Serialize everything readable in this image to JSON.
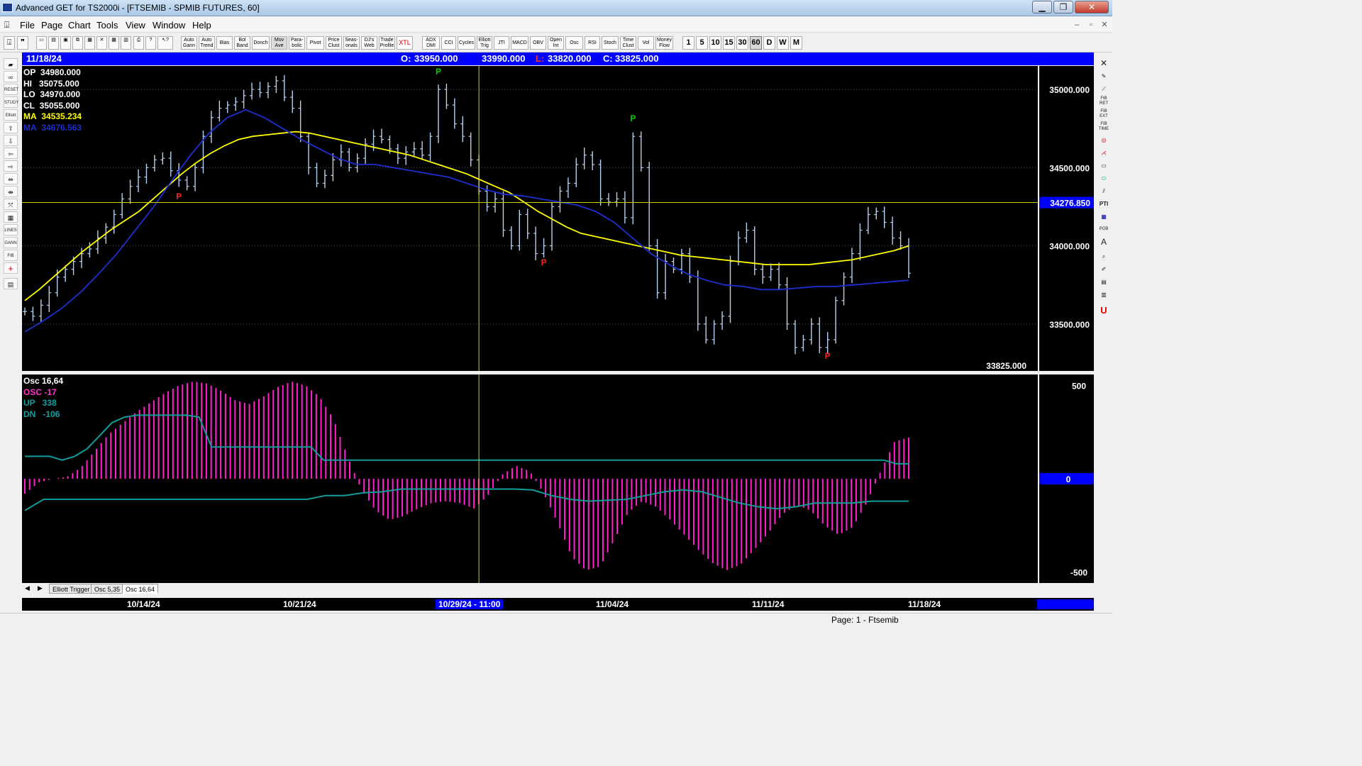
{
  "window": {
    "title": "Advanced GET for TS2000i - [FTSEMIB - SPMIB FUTURES, 60]",
    "min": "▁",
    "max": "❐",
    "close": "✕"
  },
  "menu": {
    "items": [
      "File",
      "Page",
      "Chart",
      "Tools",
      "View",
      "Window",
      "Help"
    ]
  },
  "toolbar": {
    "indicators": [
      "Auto Gann",
      "Auto Trend",
      "Bias",
      "Bol Band",
      "Donch",
      "Mov Ave",
      "Para- bolic",
      "Pivot",
      "Price Clust",
      "Seas- onals",
      "DJ's Web",
      "Trade Profile",
      "XTL",
      "ADX DMI",
      "CCI",
      "Cycles",
      "Elliott Trig",
      "JTI",
      "MACD",
      "OBV",
      "Open Int",
      "Osc",
      "RSI",
      "Stoch",
      "Time Clust",
      "Vol",
      "Money Flow"
    ],
    "intervals": [
      "1",
      "5",
      "10",
      "15",
      "30",
      "60",
      "D",
      "W",
      "M"
    ],
    "active_interval": "60"
  },
  "info": {
    "date": "11/18/24",
    "open_label": "O:",
    "open": "33950.000",
    "high": "33990.000",
    "low_label": "L:",
    "low": "33820.000",
    "close_label": "C:",
    "close": "33825.000"
  },
  "price_panel": {
    "readouts": [
      {
        "label": "OP",
        "value": "34980.000",
        "color": "#ffffff"
      },
      {
        "label": "HI",
        "value": "35075.000",
        "color": "#ffffff"
      },
      {
        "label": "LO",
        "value": "34970.000",
        "color": "#ffffff"
      },
      {
        "label": "CL",
        "value": "35055.000",
        "color": "#ffffff"
      },
      {
        "label": "MA",
        "value": "34535.234",
        "color": "#ffff00"
      },
      {
        "label": "MA",
        "value": "34676.563",
        "color": "#1e2fd0"
      }
    ],
    "axis_ticks": [
      "35000.000",
      "34500.000",
      "34000.000",
      "33500.000"
    ],
    "crosshair_price": "34276.850",
    "last_price": "33825.000",
    "pivot_label": "P"
  },
  "osc_panel": {
    "readouts": [
      {
        "label": "Osc 16,64",
        "value": "",
        "color": "#ffffff"
      },
      {
        "label": "OSC",
        "value": "-17",
        "color": "#ff33cc"
      },
      {
        "label": "UP",
        "value": "338",
        "color": "#11a0a0"
      },
      {
        "label": "DN",
        "value": "-106",
        "color": "#11a0a0"
      }
    ],
    "axis_ticks": [
      "500",
      "0",
      "-500"
    ]
  },
  "tabs": [
    "Elliott Trigger",
    "Osc 5,35",
    "Osc 16,64"
  ],
  "dates": {
    "labels": [
      "10/14/24",
      "10/21/24",
      "11/04/24",
      "11/11/24",
      "11/18/24"
    ],
    "cursor": "10/29/24 - 11:00"
  },
  "status": {
    "text": "Page: 1 - Ftsemib"
  },
  "colors": {
    "candle": "#b8d0f0",
    "ma_fast": "#ffff00",
    "ma_slow": "#1e2fd0",
    "osc": "#ff22cc",
    "band": "#119c9c",
    "pivot_high": "#00cc00",
    "pivot_low": "#ff2020",
    "info_bar": "#0000ff"
  },
  "chart_data": {
    "type": "line",
    "symbol": "FTSEMIB - SPMIB FUTURES",
    "interval": "60",
    "price_close": [
      33580,
      33550,
      33620,
      33700,
      33800,
      33850,
      33900,
      33950,
      33980,
      34050,
      34120,
      34200,
      34300,
      34380,
      34440,
      34500,
      34550,
      34560,
      34480,
      34420,
      34380,
      34500,
      34700,
      34820,
      34880,
      34900,
      34920,
      34960,
      35000,
      34980,
      35020,
      35055,
      34950,
      34880,
      34700,
      34500,
      34400,
      34450,
      34550,
      34600,
      34500,
      34560,
      34650,
      34700,
      34680,
      34620,
      34560,
      34600,
      34620,
      34580,
      34700,
      35000,
      34900,
      34780,
      34700,
      34550,
      34350,
      34250,
      34300,
      34100,
      34000,
      34200,
      34080,
      33950,
      34000,
      34250,
      34350,
      34400,
      34520,
      34580,
      34520,
      34300,
      34280,
      34300,
      34180,
      34700,
      34500,
      34000,
      33700,
      33900,
      33850,
      33950,
      33800,
      33500,
      33400,
      33500,
      33550,
      33900,
      34050,
      34100,
      33850,
      33800,
      33850,
      33750,
      33500,
      33350,
      33400,
      33500,
      33350,
      33400,
      33650,
      33800,
      33950,
      34100,
      34200,
      34220,
      34150,
      34050,
      34000,
      33825
    ],
    "ma_fast": [
      33650,
      33720,
      33800,
      33880,
      33960,
      34030,
      34100,
      34160,
      34220,
      34300,
      34380,
      34460,
      34530,
      34590,
      34640,
      34680,
      34700,
      34710,
      34720,
      34730,
      34720,
      34700,
      34680,
      34660,
      34640,
      34620,
      34600,
      34580,
      34550,
      34520,
      34490,
      34460,
      34420,
      34380,
      34340,
      34280,
      34220,
      34170,
      34120,
      34080,
      34060,
      34040,
      34020,
      34000,
      33980,
      33960,
      33940,
      33930,
      33920,
      33910,
      33900,
      33890,
      33880,
      33880,
      33880,
      33880,
      33890,
      33900,
      33910,
      33930,
      33950,
      33970,
      34000
    ],
    "ma_slow": [
      33450,
      33520,
      33600,
      33700,
      33820,
      33950,
      34100,
      34250,
      34420,
      34580,
      34720,
      34820,
      34870,
      34820,
      34750,
      34680,
      34620,
      34560,
      34520,
      34520,
      34500,
      34480,
      34460,
      34440,
      34400,
      34360,
      34330,
      34320,
      34300,
      34280,
      34260,
      34220,
      34150,
      34050,
      33950,
      33880,
      33820,
      33780,
      33750,
      33740,
      33720,
      33720,
      33730,
      33740,
      33740,
      33750,
      33760,
      33770,
      33780
    ],
    "osc": [
      -80,
      -20,
      0,
      10,
      60,
      150,
      240,
      300,
      360,
      410,
      460,
      500,
      520,
      510,
      470,
      420,
      400,
      440,
      490,
      520,
      500,
      440,
      320,
      120,
      -60,
      -170,
      -220,
      -200,
      -160,
      -130,
      -120,
      -130,
      -160,
      -90,
      20,
      70,
      40,
      -80,
      -240,
      -420,
      -490,
      -470,
      -330,
      -180,
      -120,
      -150,
      -220,
      -300,
      -380,
      -450,
      -490,
      -460,
      -380,
      -290,
      -190,
      -140,
      -170,
      -250,
      -300,
      -260,
      -130,
      40,
      200,
      220
    ],
    "up": [
      120,
      120,
      120,
      100,
      120,
      160,
      230,
      300,
      330,
      340,
      340,
      340,
      340,
      340,
      330,
      170,
      170,
      170,
      170,
      170,
      170,
      170,
      170,
      170,
      100,
      100,
      100,
      100,
      100,
      100,
      100,
      100,
      100,
      100,
      100,
      100,
      100,
      100,
      100,
      100,
      100,
      100,
      100,
      100,
      100,
      100,
      100,
      100,
      100,
      100,
      100,
      100,
      100,
      100,
      100,
      100,
      100,
      100,
      100,
      100,
      100,
      100,
      100,
      100,
      100,
      100,
      100,
      100,
      100,
      100,
      80,
      80
    ],
    "dn": [
      -170,
      -110,
      -110,
      -110,
      -110,
      -110,
      -110,
      -110,
      -110,
      -110,
      -110,
      -110,
      -110,
      -110,
      -110,
      -110,
      -90,
      -90,
      -75,
      -70,
      -55,
      -55,
      -55,
      -55,
      -55,
      -55,
      -55,
      -60,
      -90,
      -110,
      -120,
      -115,
      -110,
      -90,
      -70,
      -60,
      -70,
      -100,
      -130,
      -150,
      -160,
      -150,
      -130,
      -130,
      -130,
      -120,
      -120,
      -120
    ],
    "price_ylim": [
      33200,
      35150
    ],
    "osc_ylim": [
      -520,
      520
    ]
  }
}
